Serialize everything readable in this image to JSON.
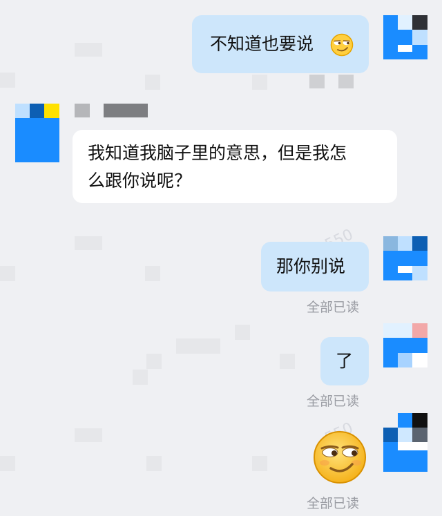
{
  "messages": [
    {
      "side": "me",
      "text": "不知道也要说",
      "emoji": "smirk-emoji"
    },
    {
      "side": "them",
      "sender_name": "",
      "text_line1": "我知道我脑子里的意思，但是我怎",
      "text_line2": "么跟你说呢？"
    },
    {
      "side": "me",
      "text": "那你别说",
      "read": "全部已读"
    },
    {
      "side": "me",
      "text": "了",
      "read": "全部已读"
    },
    {
      "side": "me",
      "emoji": "smirk-emoji",
      "read": "全部已读"
    }
  ],
  "colors": {
    "background": "#eff0f3",
    "my_bubble": "#cde6fb",
    "their_bubble": "#ffffff",
    "avatar_blue": "#1a8cff",
    "read_text": "#9a9ca3"
  }
}
